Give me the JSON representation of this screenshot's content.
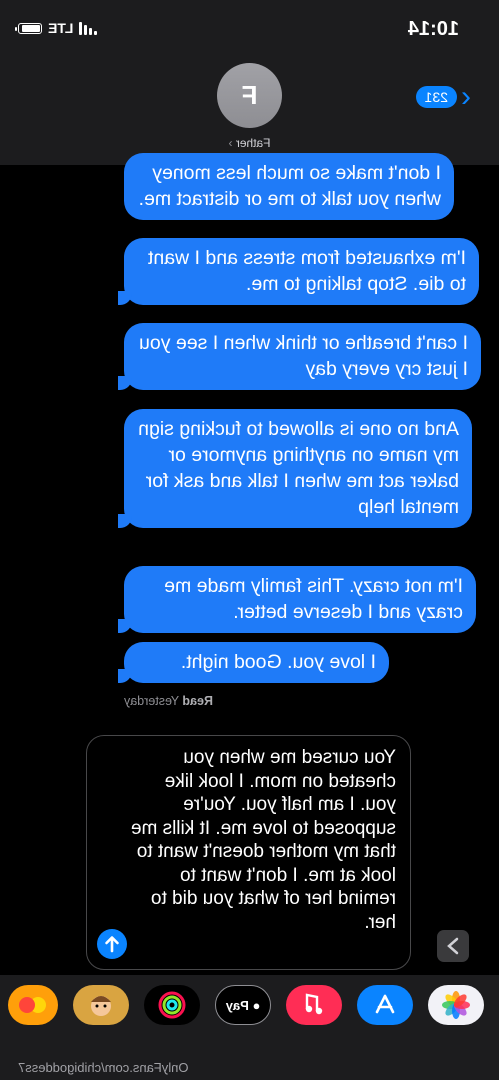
{
  "status_bar": {
    "time": "10:14",
    "network": "LTE",
    "battery_level": 0.9
  },
  "nav": {
    "back_count": "231",
    "avatar_initial": "F",
    "contact_name": "Father"
  },
  "messages": [
    "I don't make so much less money when you talk to me or distract me.",
    "I'm exhausted from stress and I want to die. Stop talking to me.",
    "I can't breathe or think when I see you I just cry every day",
    "And no one is allowed to fucking sign my name on anything anymore or baker act me when I talk and ask for mental help",
    "I'm not crazy. This family made me crazy and I deserve better.",
    "I love you. Good night."
  ],
  "read_receipt": {
    "status": "Read",
    "when": "Yesterday"
  },
  "compose": {
    "text": "You cursed me when you cheated on mom. I look like you. I am half you. You're supposed to love me. It kills me that my mother doesn't want to look at me. I don't want to remind her of what you did to her."
  },
  "app_drawer": {
    "apps": [
      {
        "name": "photos-icon"
      },
      {
        "name": "app-store-icon"
      },
      {
        "name": "music-icon"
      },
      {
        "name": "apple-pay-icon",
        "label": "Pay"
      },
      {
        "name": "fitness-icon"
      },
      {
        "name": "memoji-icon"
      },
      {
        "name": "animoji-icon"
      }
    ]
  },
  "watermark": "OnlyFans.com/chibigoddess7",
  "colors": {
    "bubble": "#1f7bf8",
    "accent": "#0a84ff",
    "header_bg": "#1c1c1e"
  }
}
